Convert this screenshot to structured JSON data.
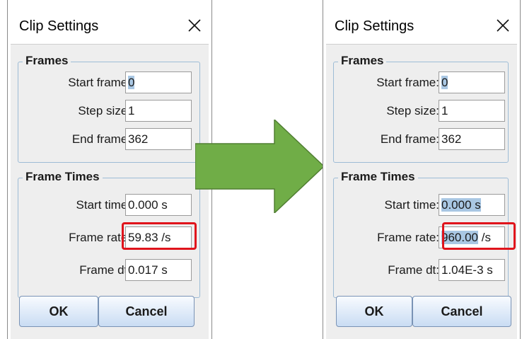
{
  "left_dialog": {
    "title": "Clip Settings",
    "frames_legend": "Frames",
    "start_frame": {
      "label": "Start frame:",
      "value": "0"
    },
    "step_size": {
      "label": "Step size:",
      "value": "1"
    },
    "end_frame": {
      "label": "End frame:",
      "value": "362"
    },
    "times_legend": "Frame Times",
    "start_time": {
      "label": "Start time:",
      "value": "0.000 s"
    },
    "frame_rate": {
      "label": "Frame rate:",
      "value": "59.83 /s"
    },
    "frame_dt": {
      "label": "Frame dt:",
      "value": "0.017 s"
    },
    "ok_label": "OK",
    "cancel_label": "Cancel"
  },
  "right_dialog": {
    "title": "Clip Settings",
    "frames_legend": "Frames",
    "start_frame": {
      "label": "Start frame:",
      "value": "0"
    },
    "step_size": {
      "label": "Step size:",
      "value": "1"
    },
    "end_frame": {
      "label": "End frame:",
      "value": "362"
    },
    "times_legend": "Frame Times",
    "start_time": {
      "label": "Start time:",
      "value": "0.000 s"
    },
    "frame_rate": {
      "label": "Frame rate:",
      "value_selected": "960.00",
      "value_rest": " /s"
    },
    "frame_dt": {
      "label": "Frame dt:",
      "value": "1.04E-3 s"
    },
    "ok_label": "OK",
    "cancel_label": "Cancel"
  },
  "colors": {
    "highlight": "#e0141c",
    "arrow": "#70ad47",
    "selection": "#a9c7e3",
    "group_border": "#9dbcd6"
  },
  "icons": {
    "close": "close-icon",
    "arrow": "right-arrow-icon"
  }
}
